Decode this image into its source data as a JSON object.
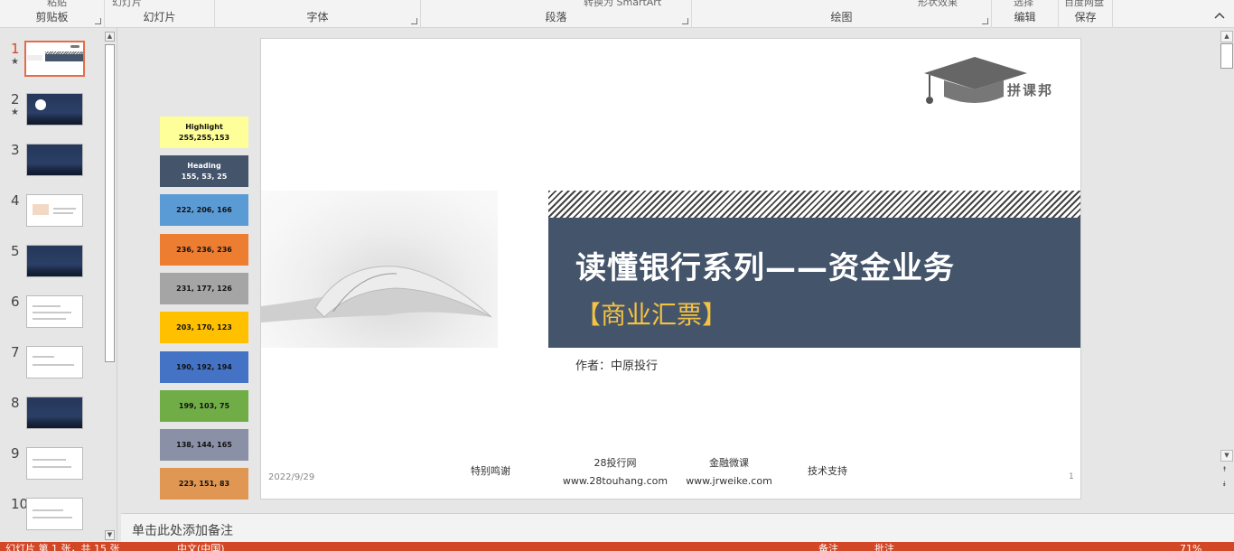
{
  "ribbon": {
    "groups": [
      {
        "label": "剪贴板",
        "cutoff": "粘贴"
      },
      {
        "label": "幻灯片",
        "cutoff": "幻灯片"
      },
      {
        "label": "字体",
        "cutoff": ""
      },
      {
        "label": "段落",
        "cutoff": "转换为 SmartArt"
      },
      {
        "label": "绘图",
        "cutoff": "形状效果"
      },
      {
        "label": "编辑",
        "cutoff": "选择"
      },
      {
        "label": "保存",
        "cutoff": "百度网盘"
      }
    ]
  },
  "thumbnails": [
    {
      "num": "1",
      "star": "★"
    },
    {
      "num": "2",
      "star": "★"
    },
    {
      "num": "3",
      "star": ""
    },
    {
      "num": "4",
      "star": ""
    },
    {
      "num": "5",
      "star": ""
    },
    {
      "num": "6",
      "star": ""
    },
    {
      "num": "7",
      "star": ""
    },
    {
      "num": "8",
      "star": ""
    },
    {
      "num": "9",
      "star": ""
    },
    {
      "num": "10",
      "star": ""
    }
  ],
  "swatches": [
    {
      "line1": "Highlight",
      "line2": "255,255,153",
      "color": "#ffff99"
    },
    {
      "line1": "Heading",
      "line2": "155, 53, 25",
      "color": "#44546a"
    },
    {
      "line1": "",
      "line2": "222, 206, 166",
      "color": "#5b9bd5"
    },
    {
      "line1": "",
      "line2": "236, 236, 236",
      "color": "#ed7d31"
    },
    {
      "line1": "",
      "line2": "231, 177, 126",
      "color": "#a5a5a5"
    },
    {
      "line1": "",
      "line2": "203, 170, 123",
      "color": "#ffc000"
    },
    {
      "line1": "",
      "line2": "190, 192, 194",
      "color": "#4472c4"
    },
    {
      "line1": "",
      "line2": "199, 103, 75",
      "color": "#70ad47"
    },
    {
      "line1": "",
      "line2": "138, 144, 165",
      "color": "#8a90a5"
    },
    {
      "line1": "",
      "line2": "223, 151, 83",
      "color": "#df9753"
    }
  ],
  "slide": {
    "title": "读懂银行系列——资金业务",
    "subtitle": "【商业汇票】",
    "author": "作者：中原投行",
    "logo_text": "拼课邦",
    "date": "2022/9/29",
    "thanks": "特别鸣谢",
    "site1_name": "28投行网",
    "site1_url": "www.28touhang.com",
    "site2_name": "金融微课",
    "site2_url": "www.jrweike.com",
    "tech": "技术支持",
    "page": "1"
  },
  "notes_placeholder": "单击此处添加备注",
  "statusbar": {
    "slide_info": "幻灯片 第 1 张，共 15 张",
    "language": "中文(中国)",
    "notes": "备注",
    "comments": "批注",
    "zoom": "71%"
  },
  "colors": {
    "accent": "#d24726",
    "heading_band": "#44546a",
    "subtitle": "#f5c242"
  }
}
